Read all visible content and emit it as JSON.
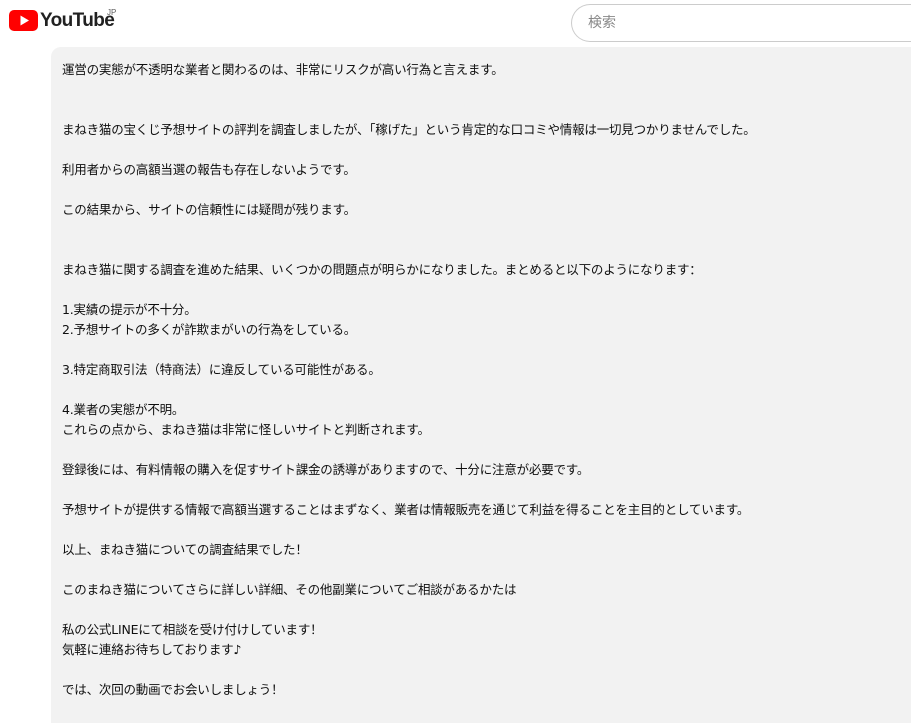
{
  "header": {
    "logo_text": "YouTube",
    "logo_region": "JP",
    "search_placeholder": "検索"
  },
  "colors": {
    "brand_red": "#ff0000",
    "panel_bg": "#f2f2f2",
    "text": "#0f0f0f"
  },
  "description": {
    "lines": [
      "運営の実態が不透明な業者と関わるのは、非常にリスクが高い行為と言えます。",
      "まねき猫の宝くじ予想サイトの評判を調査しましたが、「稼げた」という肯定的な口コミや情報は一切見つかりませんでした。",
      "利用者からの高額当選の報告も存在しないようです。",
      "この結果から、サイトの信頼性には疑問が残ります。",
      "まねき猫に関する調査を進めた結果、いくつかの問題点が明らかになりました。まとめると以下のようになります：",
      "1.実績の提示が不十分。",
      "2.予想サイトの多くが詐欺まがいの行為をしている。",
      "3.特定商取引法（特商法）に違反している可能性がある。",
      "4.業者の実態が不明。",
      "これらの点から、まねき猫は非常に怪しいサイトと判断されます。",
      "登録後には、有料情報の購入を促すサイト課金の誘導がありますので、十分に注意が必要です。",
      "予想サイトが提供する情報で高額当選することはまずなく、業者は情報販売を通じて利益を得ることを主目的としています。",
      "以上、まねき猫についての調査結果でした！",
      "このまねき猫についてさらに詳しい詳細、その他副業についてご相談があるかたは",
      "私の公式LINEにて相談を受け付けしています！",
      "気軽に連絡お待ちしております♪",
      "では、次回の動画でお会いしましょう！"
    ]
  }
}
